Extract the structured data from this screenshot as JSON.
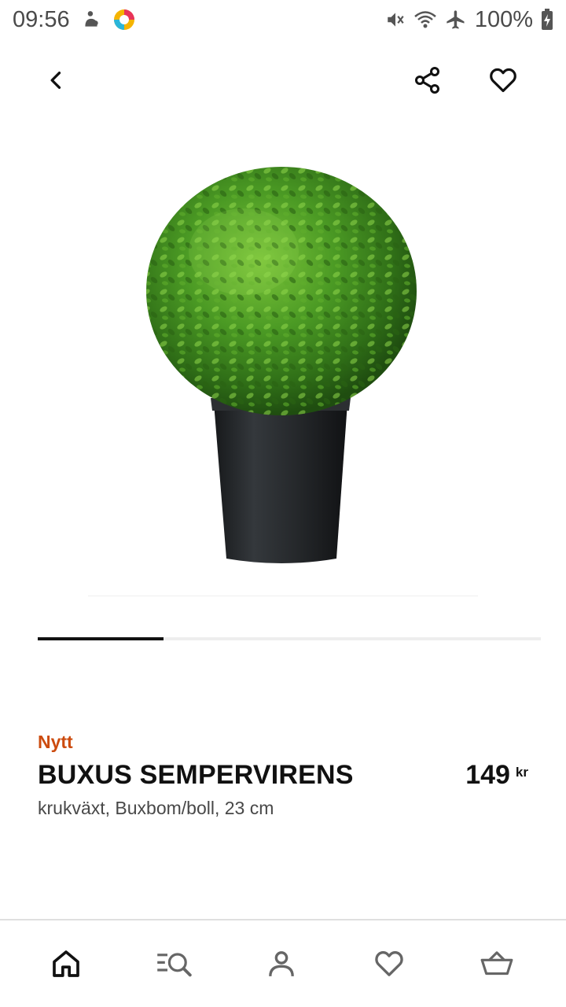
{
  "status_bar": {
    "time": "09:56",
    "battery": "100%",
    "icons": [
      "game-icon",
      "app-notification-icon",
      "mute-icon",
      "wifi-icon",
      "airplane-icon",
      "battery-charging-icon"
    ]
  },
  "top_bar": {
    "icons": [
      "back-arrow-icon",
      "share-icon",
      "heart-icon"
    ]
  },
  "carousel": {
    "current_index": 1,
    "progress_fraction": 0.25
  },
  "product": {
    "badge": "Nytt",
    "name": "BUXUS SEMPERVIRENS",
    "description": "krukväxt, Buxbom/boll, 23 cm",
    "price": "149",
    "currency": "kr"
  },
  "bottom_nav": {
    "items": [
      "home-icon",
      "search-browse-icon",
      "profile-icon",
      "favorites-icon",
      "basket-icon"
    ],
    "active": "home-icon"
  },
  "colors": {
    "accent_new": "#cc4b0e",
    "text_primary": "#111111",
    "text_secondary": "#484848"
  }
}
